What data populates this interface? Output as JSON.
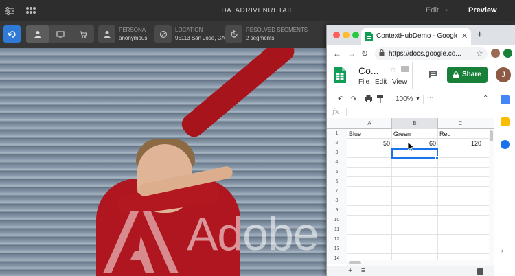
{
  "topbar": {
    "title": "DATADRIVENRETAIL",
    "edit_label": "Edit",
    "preview_label": "Preview",
    "icons": [
      "sliders-icon",
      "grid-apps-icon"
    ]
  },
  "contexthub": {
    "persona": {
      "label": "PERSONA",
      "value": "anonymous"
    },
    "location": {
      "label": "LOCATION",
      "value": "95113 San Jose, CA"
    },
    "segments": {
      "label": "RESOLVED SEGMENTS",
      "value": "2 segments"
    },
    "device_icons": [
      "user-icon",
      "desktop-icon",
      "cart-icon"
    ]
  },
  "hero": {
    "logo_text": "Adobe"
  },
  "browser": {
    "tab_title": "ContextHubDemo - Google Sheets",
    "url": "https://docs.google.co...",
    "colors": {
      "close": "#ff5f57",
      "minimize": "#febc2e",
      "maximize": "#28c840"
    }
  },
  "sheets": {
    "doc_title": "Co...",
    "menus": [
      "File",
      "Edit",
      "View"
    ],
    "share_label": "Share",
    "avatar_initial": "J",
    "zoom": "100%",
    "fx_label": "fx",
    "columns": [
      "A",
      "B",
      "C"
    ],
    "rows": [
      {
        "n": "1",
        "cells": [
          "Blue",
          "Green",
          "Red"
        ]
      },
      {
        "n": "2",
        "cells": [
          "50",
          "60",
          "120"
        ]
      },
      {
        "n": "3",
        "cells": [
          "",
          "",
          ""
        ]
      },
      {
        "n": "4",
        "cells": [
          "",
          "",
          ""
        ]
      },
      {
        "n": "5",
        "cells": [
          "",
          "",
          ""
        ]
      },
      {
        "n": "6",
        "cells": [
          "",
          "",
          ""
        ]
      },
      {
        "n": "7",
        "cells": [
          "",
          "",
          ""
        ]
      },
      {
        "n": "8",
        "cells": [
          "",
          "",
          ""
        ]
      },
      {
        "n": "9",
        "cells": [
          "",
          "",
          ""
        ]
      },
      {
        "n": "10",
        "cells": [
          "",
          "",
          ""
        ]
      },
      {
        "n": "11",
        "cells": [
          "",
          "",
          ""
        ]
      },
      {
        "n": "12",
        "cells": [
          "",
          "",
          ""
        ]
      },
      {
        "n": "13",
        "cells": [
          "",
          "",
          ""
        ]
      },
      {
        "n": "14",
        "cells": [
          "",
          "",
          ""
        ]
      }
    ],
    "bottom_icons": [
      "plus-icon",
      "list-icon"
    ]
  }
}
